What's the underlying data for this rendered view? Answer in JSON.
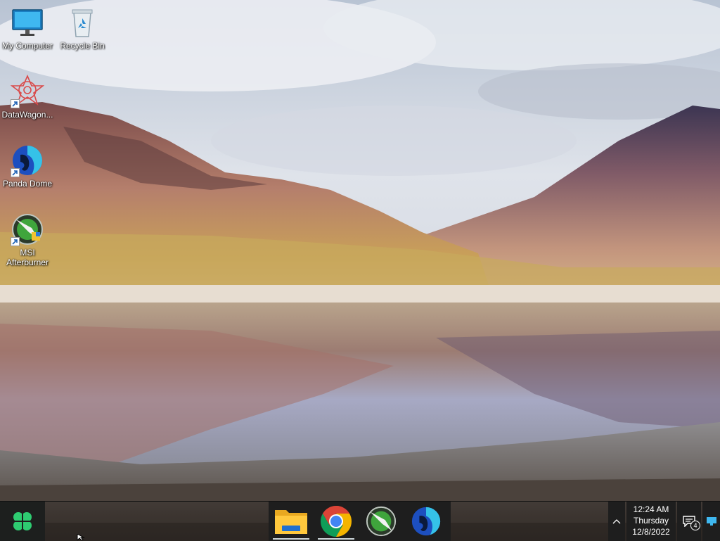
{
  "desktop": {
    "icons": [
      {
        "label": "My Computer",
        "icon": "monitor-icon"
      },
      {
        "label": "Recycle Bin",
        "icon": "recycle-bin-icon"
      },
      {
        "label": "DataWagon...",
        "icon": "datawagon-icon",
        "shortcut": true
      },
      {
        "label": "Panda Dome",
        "icon": "panda-dome-icon",
        "shortcut": true
      },
      {
        "label": "MSI Afterburner",
        "icon": "msi-afterburner-icon",
        "shortcut": true
      }
    ]
  },
  "taskbar": {
    "start_icon": "clover-start-icon",
    "start_color": "#2ecc71",
    "pinned": [
      {
        "name": "File Explorer",
        "icon": "folder-icon"
      },
      {
        "name": "Google Chrome",
        "icon": "chrome-icon"
      },
      {
        "name": "MSI Afterburner",
        "icon": "msi-afterburner-icon"
      },
      {
        "name": "Panda Dome",
        "icon": "panda-dome-icon"
      }
    ],
    "tray": {
      "chevron": "^",
      "time": "12:24 AM",
      "day": "Thursday",
      "date": "12/8/2022",
      "notification_count": "4"
    }
  },
  "colors": {
    "taskbar_bg": "#1e1e1e",
    "accent": "#2ecc71"
  }
}
